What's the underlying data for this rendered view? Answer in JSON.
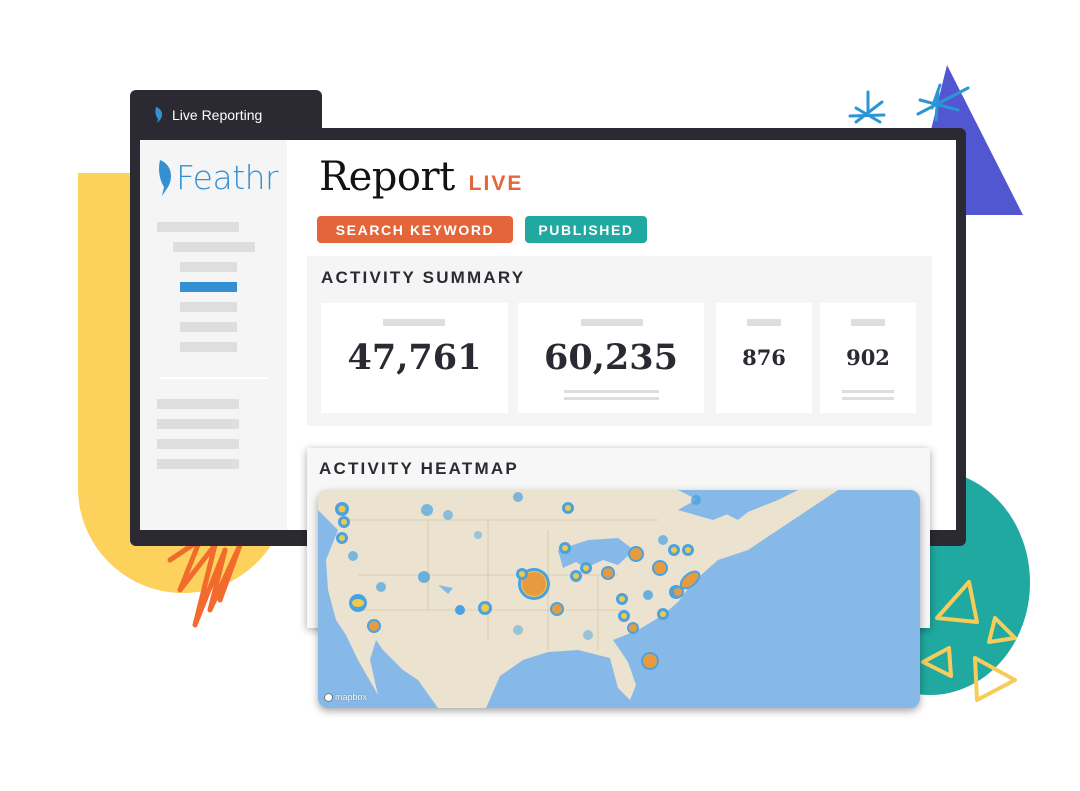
{
  "tab": {
    "title": "Live Reporting",
    "icon": "feather-icon"
  },
  "sidebar": {
    "logo_text": "Feathr",
    "nav_placeholders": 7,
    "active_index": 3,
    "bottom_placeholders": 4
  },
  "header": {
    "title": "Report",
    "status": "LIVE",
    "badges": [
      {
        "label": "SEARCH KEYWORD",
        "color": "#e36539"
      },
      {
        "label": "PUBLISHED",
        "color": "#1fa9a1"
      }
    ]
  },
  "activity_summary": {
    "title": "ACTIVITY SUMMARY",
    "cards": [
      {
        "value": "47,761"
      },
      {
        "value": "60,235"
      },
      {
        "value": "876"
      },
      {
        "value": "902"
      }
    ]
  },
  "activity_heatmap": {
    "title": "ACTIVITY HEATMAP",
    "attribution": "mapbox"
  },
  "colors": {
    "accent_orange": "#e36539",
    "accent_teal": "#1fa9a1",
    "brand_blue": "#3490d3",
    "window_dark": "#2b2a33",
    "deco_yellow": "#fcd25c",
    "deco_purple": "#5157d1"
  }
}
